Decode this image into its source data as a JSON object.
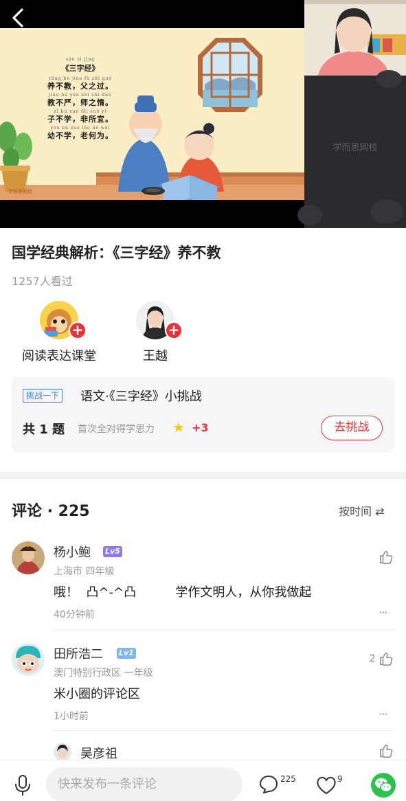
{
  "video": {
    "back_icon": "back-arrow-icon",
    "poem": {
      "title_pinyin": "sān zì jīng",
      "title": "《三字经》",
      "lines": [
        {
          "pinyin": "yǎng bù jiào  fù zhī guò",
          "text": "养不教，父之过。"
        },
        {
          "pinyin": "jiào bù yán  shī zhī duò",
          "text": "教不严，师之惰。"
        },
        {
          "pinyin": "zǐ bù xué  fēi suǒ yí",
          "text": "子不学，非所宜。"
        },
        {
          "pinyin": "yòu bù xué  lǎo hé wéi",
          "text": "幼不学，老何为。"
        }
      ]
    },
    "slide_watermark": "学而思网校",
    "camera_watermark": "学而思网校"
  },
  "lesson": {
    "title": "国学经典解析：《三字经》养不教",
    "view_count": "1257人看过"
  },
  "teachers": [
    {
      "name": "阅读表达课堂"
    },
    {
      "name": "王越"
    }
  ],
  "challenge": {
    "tag": "挑战一下",
    "title": "语文·《三字经》小挑战",
    "count": "共 1 题",
    "hint": "首次全对得学思力",
    "points": "+3",
    "button": "去挑战"
  },
  "comments_section": {
    "title": "评论 · 225",
    "sort_label": "按时间"
  },
  "comments": [
    {
      "user": "杨小鲍",
      "level": "Lv5",
      "level_color": "#8c7cf0",
      "meta": "上海市 四年级",
      "text": "哦！  凸^-^凸          学作文明人，从你我做起",
      "time": "40分钟前",
      "likes": ""
    },
    {
      "user": "田所浩二",
      "level": "Lv1",
      "level_color": "#7bb7f5",
      "meta": "澳门特别行政区 一年级",
      "text": "米小圈的评论区",
      "time": "1小时前",
      "likes": "2"
    },
    {
      "user": "吴彦祖",
      "level": "",
      "meta": "",
      "text": "",
      "time": "",
      "likes": ""
    }
  ],
  "bottom_bar": {
    "comment_placeholder": "快来发布一条评论",
    "comment_count": "225",
    "like_count": "9"
  },
  "colors": {
    "accent_red": "#e8333a",
    "tag_blue": "#3a7ee8",
    "wechat_green": "#2bc24d"
  }
}
